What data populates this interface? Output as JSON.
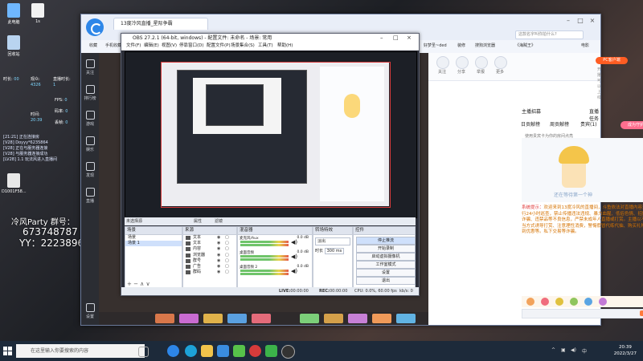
{
  "desktop": {
    "icons": [
      "此电脑",
      "1s",
      "回收站"
    ],
    "overlay": {
      "stats": {
        "col1_label": "时长:",
        "col1_value": "00",
        "viewers_label": "观众:",
        "viewers_value": "4326",
        "duration_label": "直播时长:",
        "duration_value": "1",
        "fps_label": "FPS:",
        "fps_value": "0",
        "bitrate_label": "码率:",
        "bitrate_value": "0",
        "time_label": "时间:",
        "time_value": "20:39",
        "frames_label": "丢帧:",
        "frames_value": "0"
      },
      "log_lines": [
        "[21:21]  正在连接房",
        "[V28]  Doyyy*6235864",
        "[V28]  正在与服务器连接",
        "[V28]  与服务器连接成功",
        "[LV28]  1.1 玩法风进入直播间"
      ],
      "party_line": "冷风Party 群号：",
      "qq_number": "673748787",
      "yy_line": "YY：22238969",
      "side_tags": [
        "[V28]",
        "[V28] Doyyy",
        "[小帮手]",
        "[公帮手]"
      ],
      "desk_label": "D1001F58..."
    }
  },
  "browser": {
    "tab_title": "13度冷风直播_星际争霸",
    "address_hint": "这款名字叫你拍什么?",
    "bookmarks": [
      "收藏",
      "手机收藏夹",
      "网址大全",
      "爱淘宝",
      "京东商城",
      "网易云",
      "微博",
      "视频",
      "淘宝",
      "腾讯视频"
    ],
    "bookmarks_right": [
      "好梦圣~ded",
      "装修",
      "搜狗浏览器",
      "网易新闻",
      "《海贼王》",
      "《龙之谷》",
      "电影"
    ],
    "sidebar": [
      "关注",
      "排行榜",
      "游戏",
      "娱乐",
      "发现",
      "直播",
      "设置"
    ],
    "right_panel": {
      "top_buttons": [
        "关注",
        "分享",
        "举报",
        "更多"
      ],
      "pc_badge": "PC客户端",
      "pc_sub": "开播可以上线",
      "sections": [
        "主播招募",
        "直播任务"
      ],
      "tabs": [
        "日贡献榜",
        "周贡献榜",
        "贵宾(1)",
        "粉丝"
      ],
      "open_guard": "成为守护",
      "guard_hint": "使用贵宾卡为你的房间点亮",
      "rank_caption": "还在等待第一个神",
      "chat_prefix": "系统提示：",
      "chat_text": "欢迎来到13度冷风的直播间，斗鱼依法对直播内容进行24小时巡查，禁止传播违法违规、暴力血腥、低俗色情、招嫖诈骗、违禁品等不良信息，严禁未成年人直播或打赏。主播以不正当方式诱导打赏、注意理性消费，警惕假冒代练代抽、购买礼物得到优惠等。私下交易等诈骗。",
      "send_label": "发送"
    }
  },
  "obs": {
    "title": "OBS 27.2.1 (64-bit, windows) - 配置文件: 未命名 - 场景: 常用",
    "menu": [
      "文件(F)",
      "编辑(E)",
      "视图(V)",
      "停靠窗口(D)",
      "配置文件(P)",
      "场景集合(S)",
      "工具(T)",
      "帮助(H)"
    ],
    "scene_bar": "未选择源",
    "scene_bar_buttons": [
      "属性",
      "滤镜"
    ],
    "docks": {
      "scenes": {
        "title": "场景",
        "items": [
          "场景",
          "场景 1"
        ]
      },
      "sources": {
        "title": "来源",
        "items": [
          "文本",
          "文本",
          "内容",
          "浏览器",
          "群号",
          "广告",
          "群码"
        ]
      },
      "mixer": {
        "title": "混音器",
        "tracks": [
          {
            "name": "麦克风/Aux",
            "db": "0.0 dB"
          },
          {
            "name": "桌面音频",
            "db": "0.0 dB"
          },
          {
            "name": "桌面音频 2",
            "db": "0.0 dB"
          }
        ]
      },
      "transitions": {
        "title": "转场特效",
        "type": "淡出",
        "duration_label": "时长",
        "duration_value": "300 ms"
      },
      "controls": {
        "title": "控件",
        "buttons": [
          "停止推流",
          "开始录制",
          "启动虚拟摄像机",
          "工作室模式",
          "设置",
          "退出"
        ]
      }
    },
    "status": {
      "live_label": "LIVE:",
      "live_time": "00:00:00",
      "rec_label": "REC:",
      "rec_time": "00:00:00",
      "cpu": "CPU: 0.0%, 60.00 fps",
      "kbs": "kb/s: 0"
    }
  },
  "taskbar": {
    "search_placeholder": "在这里输入你要搜索的内容",
    "time": "20:39",
    "date": "2022/3/27",
    "ime": "中"
  },
  "colors": {
    "obs_bg": "#2b2e38",
    "browser_side": "#2b2d33",
    "chat_text": "#d57200",
    "pc_badge": "#ff5d23",
    "guard_btn": "#ff6e8e"
  }
}
